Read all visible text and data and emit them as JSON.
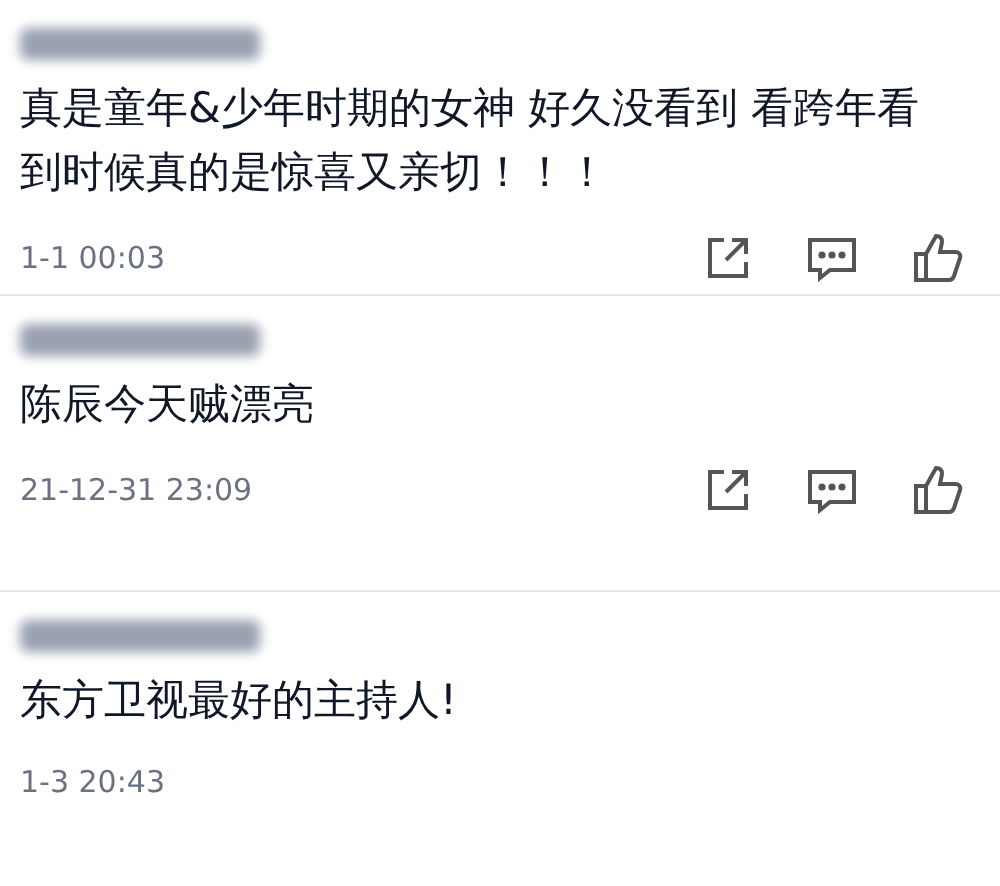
{
  "comments": [
    {
      "text": "真是童年&少年时期的女神 好久没看到 看跨年看到时候真的是惊喜又亲切！！！",
      "time": "1-1 00:03",
      "actions": true
    },
    {
      "text": "陈辰今天贼漂亮",
      "time": "21-12-31 23:09",
      "actions": true
    },
    {
      "text": "东方卫视最好的主持人!",
      "time": "1-3 20:43",
      "actions": false
    }
  ]
}
